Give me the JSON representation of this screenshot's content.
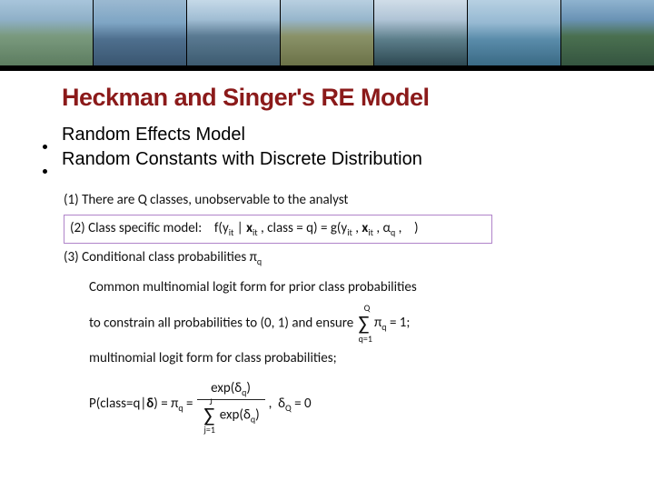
{
  "title": "Heckman and Singer's RE Model",
  "bullets": {
    "b1": "Random Effects Model",
    "b2": "Random Constants with Discrete Distribution"
  },
  "math": {
    "line1_prefix": "(1) There are Q classes, unobservable to the analyst",
    "line2_prefix": "(2) Class specific model:",
    "line2_formula": "f(yit | xit , class = q) = g(yit , xit , αq ,    )",
    "line3": "(3) Conditional class probabilities πq",
    "line4": "Common multinomial logit form for prior class probabilities",
    "line5_a": "to constrain all probabilities to (0, 1) and ensure",
    "line5_sum": "∑",
    "line5_b": "πq = 1;",
    "line6": "multinomial logit form for class probabilities;",
    "line7_left": "P(class=q|δ) = πq =",
    "line7_num": "exp(δq)",
    "line7_den_sum": "∑",
    "line7_den": "exp(δq)",
    "line7_tail": ",  δQ = 0",
    "sum_upper_Q": "Q",
    "sum_lower_q1": "q=1",
    "sum_upper_J": "J",
    "sum_lower_j1": "j=1"
  }
}
